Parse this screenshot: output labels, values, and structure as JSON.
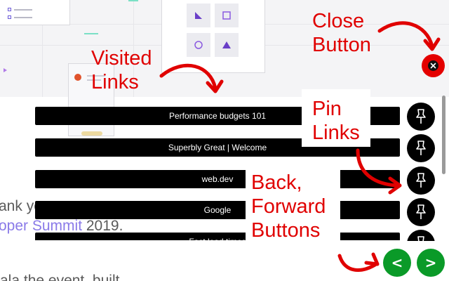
{
  "visited_links": [
    {
      "title": "Performance budgets 101"
    },
    {
      "title": "Superbly Great | Welcome"
    },
    {
      "title": "web.dev"
    },
    {
      "title": "Google"
    },
    {
      "title": "Fast load times"
    }
  ],
  "pin_links": {
    "icon": "pin-icon",
    "count": 5
  },
  "close_button": {
    "icon": "close-icon",
    "color": "#e40000"
  },
  "navigation": {
    "back_label": "<",
    "forward_label": ">",
    "color": "#0a9a28"
  },
  "annotations": {
    "visited_line1": "Visited",
    "visited_line2": "Links",
    "close_line1": "Close",
    "close_line2": "Button",
    "pin_line1": "Pin",
    "pin_line2": "Links",
    "nav_line1": "Back,",
    "nav_line2": "Forward",
    "nav_line3": "Buttons",
    "color": "#e00000"
  },
  "background_page": {
    "text_line1": "ank yo",
    "text_line2_a": "oper Summit",
    "text_line2_b": " 2019.",
    "text_line3": "ala the event, built",
    "accent_color": "#8a7ae8"
  }
}
